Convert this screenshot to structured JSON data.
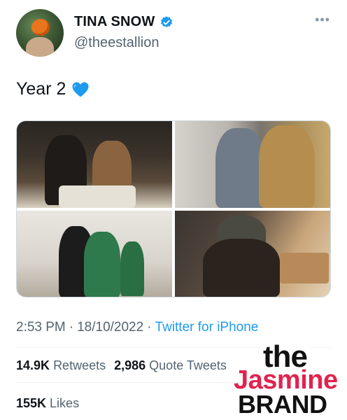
{
  "author": {
    "display_name": "TINA SNOW",
    "handle": "@theestallion",
    "verified": true,
    "avatar_icon": "pumpkin-avatar"
  },
  "more_label": "•••",
  "tweet": {
    "text": "Year 2",
    "emoji_icon": "blue-heart-icon",
    "media": [
      {
        "alt_icon": "photo-1"
      },
      {
        "alt_icon": "photo-2"
      },
      {
        "alt_icon": "photo-3"
      },
      {
        "alt_icon": "photo-4"
      }
    ]
  },
  "meta": {
    "time": "2:53 PM",
    "separator": "·",
    "date": "18/10/2022",
    "source": "Twitter for iPhone"
  },
  "stats": {
    "retweets_count": "14.9K",
    "retweets_label": "Retweets",
    "quotes_count": "2,986",
    "quotes_label": "Quote Tweets",
    "likes_count": "155K",
    "likes_label": "Likes"
  },
  "watermark": {
    "line1": "the",
    "line2": "Jasmine",
    "line3": "BRAND"
  },
  "colors": {
    "verified_blue": "#1d9bf0",
    "heart_blue": "#1d9bf0",
    "link_blue": "#1d9bf0",
    "secondary_text": "#536471",
    "watermark_pink": "#e1234f"
  }
}
